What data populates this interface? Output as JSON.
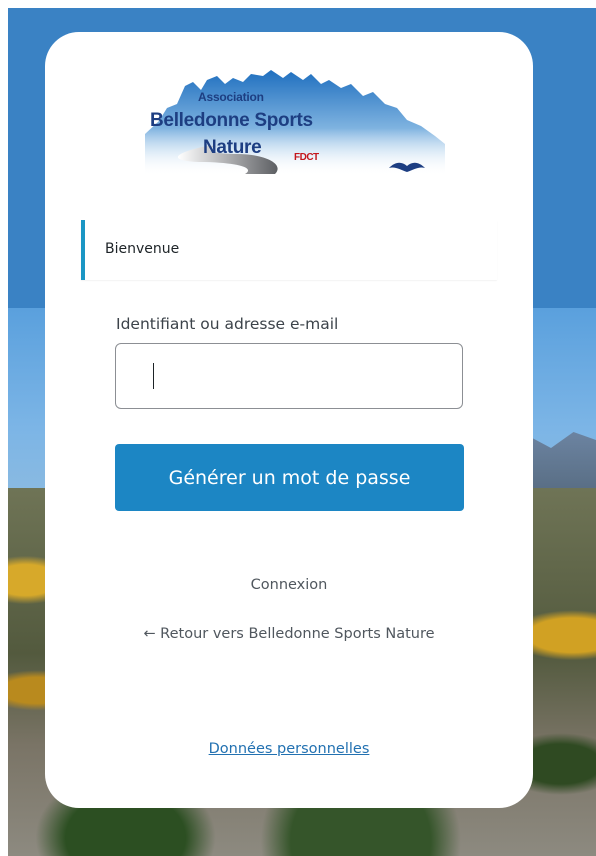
{
  "logo": {
    "line1": "Association",
    "line2": "Belledonne Sports",
    "line3": "Nature",
    "badge": "FDCT",
    "colors": {
      "text": "#1d3e82",
      "sky": "#2a7bc4",
      "badge": "#c4161c"
    }
  },
  "message": {
    "text": "Bienvenue"
  },
  "form": {
    "username_label": "Identifiant ou adresse e-mail",
    "username_value": "",
    "submit_label": "Générer un mot de passe"
  },
  "links": {
    "login": "Connexion",
    "back": "← Retour vers Belledonne Sports Nature",
    "privacy": "Données personnelles"
  },
  "colors": {
    "accent": "#1c86c4",
    "message_border": "#1a96c4",
    "link": "#2271b1"
  }
}
